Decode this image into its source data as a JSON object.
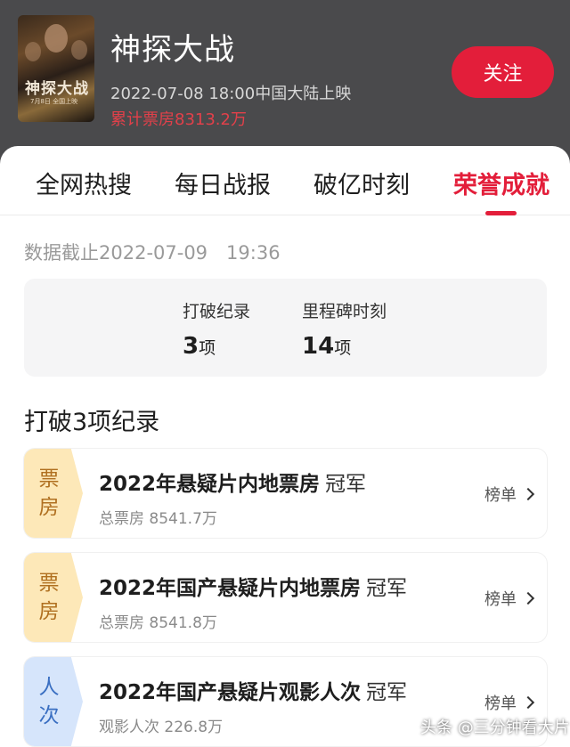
{
  "header": {
    "movie_title": "神探大战",
    "release": "2022-07-08 18:00中国大陆上映",
    "boxoffice": "累计票房8313.2万",
    "follow_label": "关注",
    "poster_title": "神探大战",
    "poster_sub": "7月8日 全国上映"
  },
  "tabs": [
    {
      "label": "全网热搜",
      "active": false
    },
    {
      "label": "每日战报",
      "active": false
    },
    {
      "label": "破亿时刻",
      "active": false
    },
    {
      "label": "荣誉成就",
      "active": true
    }
  ],
  "cutoff": "数据截止2022-07-09　19:36",
  "summary": {
    "records_label": "打破纪录",
    "records_value": "3",
    "records_unit": "项",
    "milestones_label": "里程碑时刻",
    "milestones_value": "14",
    "milestones_unit": "项"
  },
  "section_title": "打破3项纪录",
  "records": [
    {
      "badge": [
        "票",
        "房"
      ],
      "badge_color": "yellow",
      "title": "2022年悬疑片内地票房",
      "rank": "冠军",
      "sub": "总票房 8541.7万",
      "link": "榜单"
    },
    {
      "badge": [
        "票",
        "房"
      ],
      "badge_color": "yellow",
      "title": "2022年国产悬疑片内地票房",
      "rank": "冠军",
      "sub": "总票房 8541.8万",
      "link": "榜单"
    },
    {
      "badge": [
        "人",
        "次"
      ],
      "badge_color": "blue",
      "title": "2022年国产悬疑片观影人次",
      "rank": "冠军",
      "sub": "观影人次 226.8万",
      "link": "榜单"
    }
  ],
  "watermark": "头条 @三分钟看大片",
  "colors": {
    "accent": "#e31e3a",
    "header_bg": "#4a4a4c"
  }
}
